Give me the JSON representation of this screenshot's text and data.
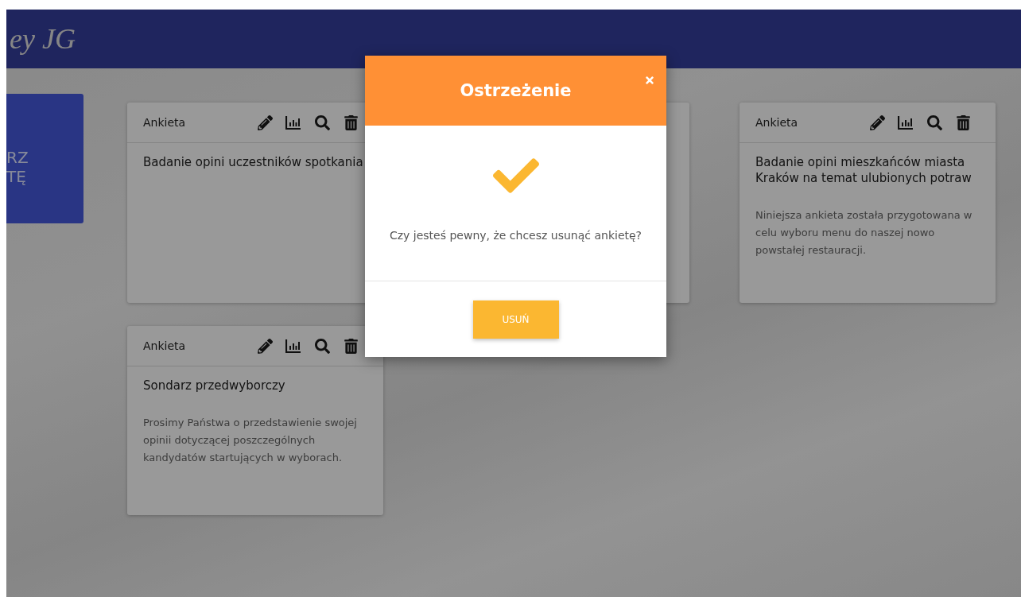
{
  "header": {
    "logo": "ey JG"
  },
  "create_tile": {
    "lines": [
      "RZ",
      "TĘ"
    ]
  },
  "cards": [
    {
      "kind": "survey",
      "label": "Ankieta",
      "title": "Badanie opini uczestników spotkania"
    },
    {
      "kind": "covered"
    },
    {
      "kind": "survey",
      "label": "Ankieta",
      "title": "Badanie opini mieszkańców miasta Kraków na temat ulubionych potraw",
      "description": "Niniejsza ankieta została przygotowana w celu wyboru menu do naszej nowo powstałej restauracji."
    },
    {
      "kind": "survey",
      "label": "Ankieta",
      "title": "Sondarz przedwyborczy",
      "description": "Prosimy Państwa o przedstawienie swojej opinii dotyczącej poszczególnych kandydatów startujących w wyborach."
    }
  ],
  "dialog": {
    "title": "Ostrzeżenie",
    "message": "Czy jesteś pewny, że chcesz usunąć ankietę?",
    "button": "USUŃ"
  }
}
